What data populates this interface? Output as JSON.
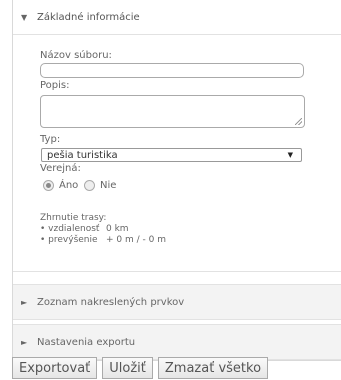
{
  "sections": {
    "basic_info": {
      "title": "Základné informácie",
      "expanded": true
    },
    "drawn_items": {
      "title": "Zoznam nakreslených prvkov",
      "expanded": false
    },
    "export_settings": {
      "title": "Nastavenia exportu",
      "expanded": false
    }
  },
  "form": {
    "filename_label": "Názov súboru:",
    "filename_value": "",
    "description_label": "Popis:",
    "description_value": "",
    "type_label": "Typ:",
    "type_selected": "pešia turistika",
    "public_label": "Verejná:",
    "public_yes": "Áno",
    "public_no": "Nie",
    "public_selected": "yes"
  },
  "summary": {
    "title": "Zhrnutie trasy:",
    "distance_label": "• vzdialenosť",
    "distance_value": "0 km",
    "elevation_label": "• prevýšenie",
    "elevation_value": "+ 0 m / - 0 m"
  },
  "buttons": {
    "export": "Exportovať",
    "save": "Uložiť",
    "clear": "Zmazať všetko"
  },
  "icons": {
    "expanded": "triangle-down",
    "collapsed": "triangle-right",
    "select_caret": "caret-down"
  }
}
